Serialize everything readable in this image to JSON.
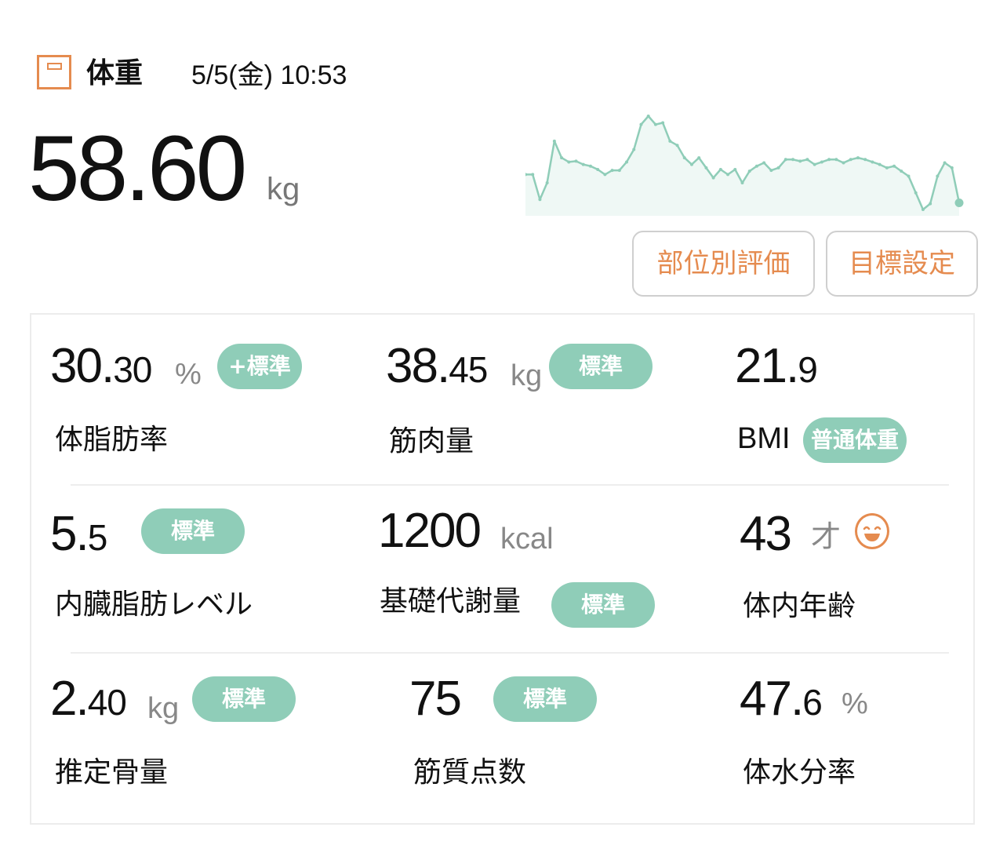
{
  "header": {
    "icon": "scale-icon",
    "title": "体重",
    "datetime": "5/5(金) 10:53"
  },
  "weight": {
    "value": "58.60",
    "unit": "kg"
  },
  "buttons": {
    "part_eval": "部位別評価",
    "goal_setting": "目標設定"
  },
  "colors": {
    "accent": "#e58b4f",
    "badge": "#8fcdb8",
    "sparkline": "#8fcdb8"
  },
  "metrics": {
    "body_fat": {
      "int": "30.",
      "dec": "30",
      "unit": "%",
      "badge": "+標準",
      "label": "体脂肪率"
    },
    "muscle_mass": {
      "int": "38.",
      "dec": "45",
      "unit": "kg",
      "badge": "標準",
      "label": "筋肉量"
    },
    "bmi": {
      "int": "21.",
      "dec": "9",
      "badge": "普通体重",
      "label": "BMI"
    },
    "visceral_fat": {
      "int": "5.",
      "dec": "5",
      "badge": "標準",
      "label": "内臓脂肪レベル"
    },
    "bmr": {
      "int": "1200",
      "unit": "kcal",
      "badge": "標準",
      "label": "基礎代謝量"
    },
    "body_age": {
      "int": "43",
      "unit": "才",
      "icon": "smiley-face-icon",
      "label": "体内年齢"
    },
    "bone_mass": {
      "int": "2.",
      "dec": "40",
      "unit": "kg",
      "badge": "標準",
      "label": "推定骨量"
    },
    "muscle_quality": {
      "int": "75",
      "badge": "標準",
      "label": "筋質点数"
    },
    "body_water": {
      "int": "47.",
      "dec": "6",
      "unit": "%",
      "label": "体水分率"
    }
  },
  "sparkline": {
    "values": [
      62,
      62,
      59,
      61,
      66,
      64,
      63.5,
      63.6,
      63.2,
      63,
      62.6,
      62,
      62.5,
      62.5,
      63.5,
      65,
      68,
      69,
      68,
      68.2,
      66,
      65.5,
      64,
      63.2,
      64,
      62.8,
      61.6,
      62.6,
      62,
      62.6,
      61,
      62.4,
      63,
      63.4,
      62.5,
      62.8,
      63.8,
      63.8,
      63.6,
      63.8,
      63.2,
      63.5,
      63.8,
      63.8,
      63.4,
      63.8,
      64,
      63.8,
      63.5,
      63.2,
      62.8,
      63,
      62.4,
      61.8,
      59.8,
      57.8,
      58.5,
      61.8,
      63.4,
      62.8,
      58.6
    ]
  }
}
